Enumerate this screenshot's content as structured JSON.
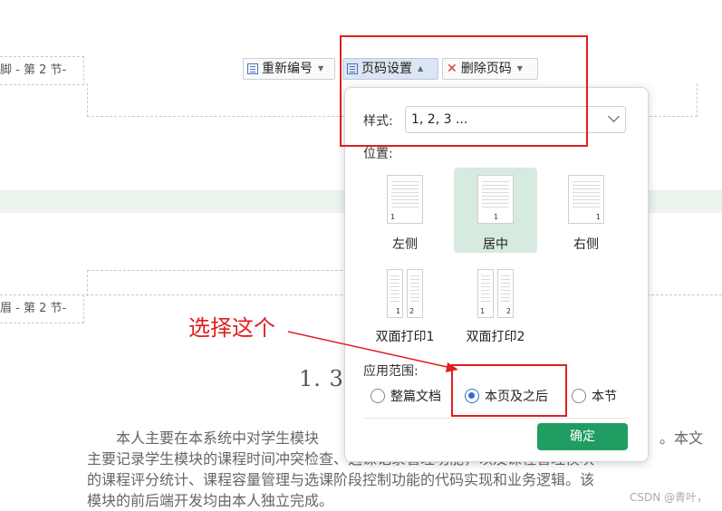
{
  "document": {
    "section_tag_top": "脚 - 第 2 节-",
    "section_tag_mid": "眉 - 第 2 节-",
    "heading": "1. 3",
    "paragraph_lines": [
      "　　本人主要在本系统中对学生模块",
      "主要记录学生模块的课程时间冲突检查、选课记录管理功能，以及课程管理模块",
      "的课程评分统计、课程容量管理与选课阶段控制功能的代码实现和业务逻辑。该",
      "模块的前后端开发均由本人独立完成。"
    ],
    "paragraph_tail": "。本文",
    "watermark": "CSDN @青叶，"
  },
  "toolbar": {
    "renumber_label": "重新编号",
    "page_settings_label": "页码设置",
    "delete_label": "删除页码"
  },
  "dialog": {
    "style_label": "样式:",
    "style_value": "1, 2, 3 ...",
    "position_label": "位置:",
    "positions": [
      {
        "label": "左侧",
        "num": "1"
      },
      {
        "label": "居中",
        "num": "1"
      },
      {
        "label": "右侧",
        "num": "1"
      },
      {
        "label": "双面打印1",
        "num_a": "1",
        "num_b": "2"
      },
      {
        "label": "双面打印2",
        "num_a": "1",
        "num_b": "2"
      }
    ],
    "selected_position": "居中",
    "scope_label": "应用范围:",
    "scope_options": [
      "整篇文档",
      "本页及之后",
      "本节"
    ],
    "selected_scope": "本页及之后",
    "ok_label": "确定"
  },
  "annotation": {
    "text": "选择这个",
    "color": "#e01f1f"
  },
  "colors": {
    "accent_green": "#1f9d62",
    "selection_green": "#d7eadf",
    "radio_blue": "#2f6fd1"
  }
}
